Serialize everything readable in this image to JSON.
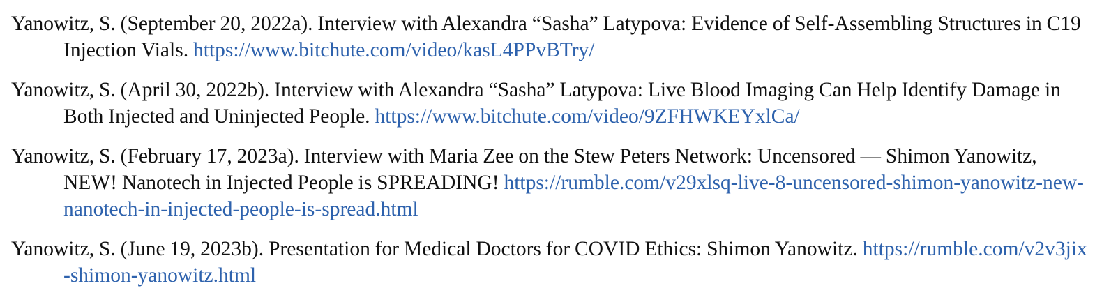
{
  "references": [
    {
      "text": "Yanowitz, S. (September 20, 2022a). Interview with Alexandra “Sasha” Latypova: Evidence of Self-Assembling Structures in C19 Injection Vials. ",
      "url": "https://www.bitchute.com/video/kasL4PPvBTry/"
    },
    {
      "text": "Yanowitz, S. (April 30, 2022b). Interview with Alexandra “Sasha” Latypova: Live Blood Imaging Can Help Identify Damage in Both Injected and Uninjected People. ",
      "url": "https://www.bitchute.com/video/9ZFHWKEYxlCa/"
    },
    {
      "text": "Yanowitz, S. (February 17, 2023a). Interview with Maria Zee on the Stew Peters Network: Uncensored — Shimon Yanowitz, NEW! Nanotech in Injected People is SPREADING! ",
      "url": "https://rumble.com/v29xlsq-live-8-uncensored-shimon-yanowitz-new-nanotech-in-injected-people-is-spread.html"
    },
    {
      "text": "Yanowitz, S.  (June 19, 2023b). Presentation for Medical Doctors for COVID Ethics: Shimon Yanowitz. ",
      "url": "https://rumble.com/v2v3jix-shimon-yanowitz.html"
    }
  ],
  "colors": {
    "text": "#111111",
    "link": "#2e62ad"
  }
}
